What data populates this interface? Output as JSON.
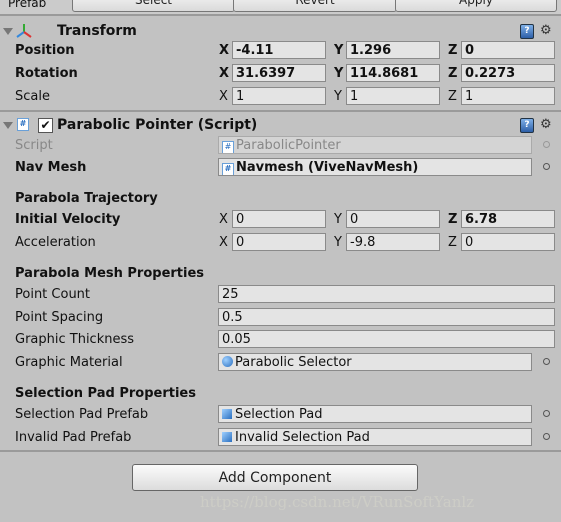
{
  "prefab_bar": {
    "label": "Prefab",
    "select": "Select",
    "revert": "Revert",
    "apply": "Apply"
  },
  "transform": {
    "title": "Transform",
    "position": {
      "label": "Position",
      "x": "-4.11",
      "y": "1.296",
      "z": "0"
    },
    "rotation": {
      "label": "Rotation",
      "x": "31.6397",
      "y": "114.8681",
      "z": "0.2273"
    },
    "scale": {
      "label": "Scale",
      "x": "1",
      "y": "1",
      "z": "1"
    }
  },
  "axes": {
    "x": "X",
    "y": "Y",
    "z": "Z"
  },
  "component": {
    "title": "Parabolic Pointer (Script)",
    "enabled": true,
    "script": {
      "label": "Script",
      "value": "ParabolicPointer"
    },
    "nav_mesh": {
      "label": "Nav Mesh",
      "value": "Navmesh (ViveNavMesh)"
    },
    "trajectory_header": "Parabola Trajectory",
    "initial_velocity": {
      "label": "Initial Velocity",
      "x": "0",
      "y": "0",
      "z": "6.78"
    },
    "acceleration": {
      "label": "Acceleration",
      "x": "0",
      "y": "-9.8",
      "z": "0"
    },
    "mesh_header": "Parabola Mesh Properties",
    "point_count": {
      "label": "Point Count",
      "value": "25"
    },
    "point_spacing": {
      "label": "Point Spacing",
      "value": "0.5"
    },
    "graphic_thickness": {
      "label": "Graphic Thickness",
      "value": "0.05"
    },
    "graphic_material": {
      "label": "Graphic Material",
      "value": "Parabolic Selector"
    },
    "pad_header": "Selection Pad Properties",
    "selection_pad_prefab": {
      "label": "Selection Pad Prefab",
      "value": "Selection Pad"
    },
    "invalid_pad_prefab": {
      "label": "Invalid Pad Prefab",
      "value": "Invalid Selection Pad"
    }
  },
  "add_component": "Add Component",
  "watermark": "https://blog.csdn.net/VRunSoftYanlz"
}
